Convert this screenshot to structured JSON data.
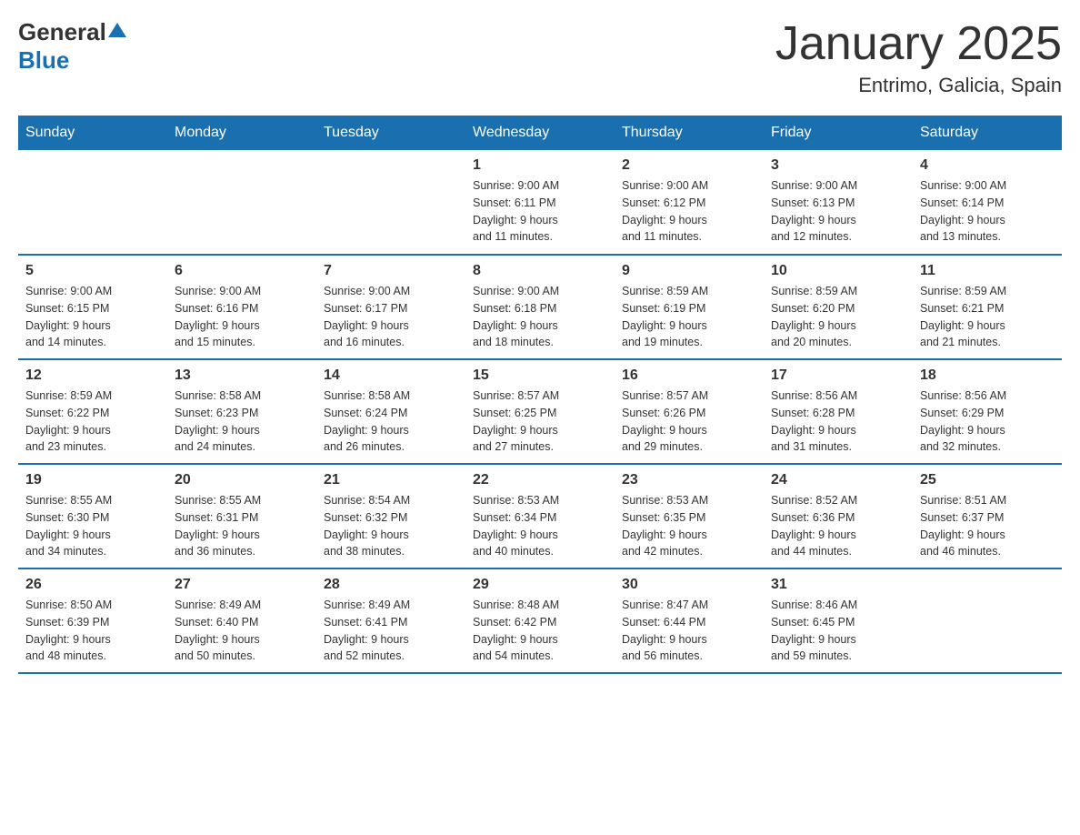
{
  "logo": {
    "general": "General",
    "blue": "Blue"
  },
  "title": "January 2025",
  "subtitle": "Entrimo, Galicia, Spain",
  "days_header": [
    "Sunday",
    "Monday",
    "Tuesday",
    "Wednesday",
    "Thursday",
    "Friday",
    "Saturday"
  ],
  "weeks": [
    [
      {
        "day": "",
        "info": ""
      },
      {
        "day": "",
        "info": ""
      },
      {
        "day": "",
        "info": ""
      },
      {
        "day": "1",
        "info": "Sunrise: 9:00 AM\nSunset: 6:11 PM\nDaylight: 9 hours\nand 11 minutes."
      },
      {
        "day": "2",
        "info": "Sunrise: 9:00 AM\nSunset: 6:12 PM\nDaylight: 9 hours\nand 11 minutes."
      },
      {
        "day": "3",
        "info": "Sunrise: 9:00 AM\nSunset: 6:13 PM\nDaylight: 9 hours\nand 12 minutes."
      },
      {
        "day": "4",
        "info": "Sunrise: 9:00 AM\nSunset: 6:14 PM\nDaylight: 9 hours\nand 13 minutes."
      }
    ],
    [
      {
        "day": "5",
        "info": "Sunrise: 9:00 AM\nSunset: 6:15 PM\nDaylight: 9 hours\nand 14 minutes."
      },
      {
        "day": "6",
        "info": "Sunrise: 9:00 AM\nSunset: 6:16 PM\nDaylight: 9 hours\nand 15 minutes."
      },
      {
        "day": "7",
        "info": "Sunrise: 9:00 AM\nSunset: 6:17 PM\nDaylight: 9 hours\nand 16 minutes."
      },
      {
        "day": "8",
        "info": "Sunrise: 9:00 AM\nSunset: 6:18 PM\nDaylight: 9 hours\nand 18 minutes."
      },
      {
        "day": "9",
        "info": "Sunrise: 8:59 AM\nSunset: 6:19 PM\nDaylight: 9 hours\nand 19 minutes."
      },
      {
        "day": "10",
        "info": "Sunrise: 8:59 AM\nSunset: 6:20 PM\nDaylight: 9 hours\nand 20 minutes."
      },
      {
        "day": "11",
        "info": "Sunrise: 8:59 AM\nSunset: 6:21 PM\nDaylight: 9 hours\nand 21 minutes."
      }
    ],
    [
      {
        "day": "12",
        "info": "Sunrise: 8:59 AM\nSunset: 6:22 PM\nDaylight: 9 hours\nand 23 minutes."
      },
      {
        "day": "13",
        "info": "Sunrise: 8:58 AM\nSunset: 6:23 PM\nDaylight: 9 hours\nand 24 minutes."
      },
      {
        "day": "14",
        "info": "Sunrise: 8:58 AM\nSunset: 6:24 PM\nDaylight: 9 hours\nand 26 minutes."
      },
      {
        "day": "15",
        "info": "Sunrise: 8:57 AM\nSunset: 6:25 PM\nDaylight: 9 hours\nand 27 minutes."
      },
      {
        "day": "16",
        "info": "Sunrise: 8:57 AM\nSunset: 6:26 PM\nDaylight: 9 hours\nand 29 minutes."
      },
      {
        "day": "17",
        "info": "Sunrise: 8:56 AM\nSunset: 6:28 PM\nDaylight: 9 hours\nand 31 minutes."
      },
      {
        "day": "18",
        "info": "Sunrise: 8:56 AM\nSunset: 6:29 PM\nDaylight: 9 hours\nand 32 minutes."
      }
    ],
    [
      {
        "day": "19",
        "info": "Sunrise: 8:55 AM\nSunset: 6:30 PM\nDaylight: 9 hours\nand 34 minutes."
      },
      {
        "day": "20",
        "info": "Sunrise: 8:55 AM\nSunset: 6:31 PM\nDaylight: 9 hours\nand 36 minutes."
      },
      {
        "day": "21",
        "info": "Sunrise: 8:54 AM\nSunset: 6:32 PM\nDaylight: 9 hours\nand 38 minutes."
      },
      {
        "day": "22",
        "info": "Sunrise: 8:53 AM\nSunset: 6:34 PM\nDaylight: 9 hours\nand 40 minutes."
      },
      {
        "day": "23",
        "info": "Sunrise: 8:53 AM\nSunset: 6:35 PM\nDaylight: 9 hours\nand 42 minutes."
      },
      {
        "day": "24",
        "info": "Sunrise: 8:52 AM\nSunset: 6:36 PM\nDaylight: 9 hours\nand 44 minutes."
      },
      {
        "day": "25",
        "info": "Sunrise: 8:51 AM\nSunset: 6:37 PM\nDaylight: 9 hours\nand 46 minutes."
      }
    ],
    [
      {
        "day": "26",
        "info": "Sunrise: 8:50 AM\nSunset: 6:39 PM\nDaylight: 9 hours\nand 48 minutes."
      },
      {
        "day": "27",
        "info": "Sunrise: 8:49 AM\nSunset: 6:40 PM\nDaylight: 9 hours\nand 50 minutes."
      },
      {
        "day": "28",
        "info": "Sunrise: 8:49 AM\nSunset: 6:41 PM\nDaylight: 9 hours\nand 52 minutes."
      },
      {
        "day": "29",
        "info": "Sunrise: 8:48 AM\nSunset: 6:42 PM\nDaylight: 9 hours\nand 54 minutes."
      },
      {
        "day": "30",
        "info": "Sunrise: 8:47 AM\nSunset: 6:44 PM\nDaylight: 9 hours\nand 56 minutes."
      },
      {
        "day": "31",
        "info": "Sunrise: 8:46 AM\nSunset: 6:45 PM\nDaylight: 9 hours\nand 59 minutes."
      },
      {
        "day": "",
        "info": ""
      }
    ]
  ]
}
